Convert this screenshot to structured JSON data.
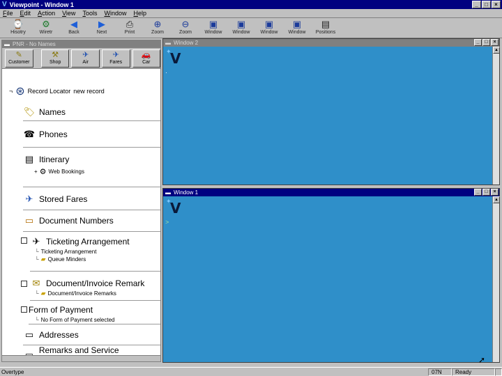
{
  "window": {
    "title": "Viewpoint - Window 1",
    "app_icon": "V",
    "controls": {
      "minimize": "_",
      "maximize": "□",
      "close": "×"
    }
  },
  "menu": [
    "File",
    "Edit",
    "Action",
    "View",
    "Tools",
    "Window",
    "Help"
  ],
  "toolbar": {
    "tools": [
      {
        "label": "Hisotry",
        "icon": "history-icon",
        "glyph": "⌚"
      },
      {
        "label": "Wiretr",
        "icon": "wireless-icon",
        "glyph": "⚙"
      },
      {
        "label": "Back",
        "icon": "back-arrow-icon",
        "glyph": "◀"
      },
      {
        "label": "Next",
        "icon": "next-arrow-icon",
        "glyph": "▶"
      },
      {
        "label": "Print",
        "icon": "printer-icon",
        "glyph": "⎙"
      },
      {
        "label": "Zoom",
        "icon": "zoom-in-icon",
        "glyph": "⊕"
      },
      {
        "label": "Zoom",
        "icon": "zoom-out-icon",
        "glyph": "⊖"
      },
      {
        "label": "Window",
        "icon": "window-1-icon",
        "glyph": "▣"
      },
      {
        "label": "Window",
        "icon": "window-2-icon",
        "glyph": "▣"
      },
      {
        "label": "Window",
        "icon": "window-3-icon",
        "glyph": "▣"
      },
      {
        "label": "Window",
        "icon": "window-4-icon",
        "glyph": "▣"
      },
      {
        "label": "Positions",
        "icon": "positions-icon",
        "glyph": "▤"
      }
    ]
  },
  "pnr": {
    "title": "PNR - No Names",
    "buttons": [
      {
        "label": "Customer",
        "icon": "customer-icon",
        "glyph": "✎"
      },
      {
        "label": "Shop",
        "icon": "shop-icon",
        "glyph": "⚒"
      },
      {
        "label": "Air",
        "icon": "air-icon",
        "glyph": "✈"
      },
      {
        "label": "Fares",
        "icon": "fares-icon",
        "glyph": "✈"
      },
      {
        "label": "Car",
        "icon": "car-icon",
        "glyph": "🚗"
      }
    ],
    "record_locator_label": "Record Locator",
    "record_locator_value": "new record",
    "sections": [
      {
        "name": "Names",
        "icon": "names-tag-icon",
        "glyph": "🏷"
      },
      {
        "name": "Phones",
        "icon": "phone-icon",
        "glyph": "☎"
      },
      {
        "name": "Itinerary",
        "icon": "itinerary-icon",
        "glyph": "▤"
      },
      {
        "name": "Stored Fares",
        "icon": "stored-fares-icon",
        "glyph": "✈"
      },
      {
        "name": "Document Numbers",
        "icon": "document-numbers-icon",
        "glyph": "▭"
      },
      {
        "name": "Ticketing Arrangement",
        "icon": "ticketing-icon",
        "glyph": "✈"
      },
      {
        "name": "Document/Invoice Remark",
        "icon": "invoice-remark-icon",
        "glyph": "✉"
      },
      {
        "name": "Form of Payment"
      },
      {
        "name": "Addresses",
        "icon": "address-icon",
        "glyph": "▭"
      },
      {
        "name": "Remarks and Service Information",
        "icon": "remarks-icon",
        "glyph": "▭"
      }
    ],
    "web_bookings": "Web Bookings",
    "ticketing_sub": [
      "Ticketing Arrangement",
      "Queue Minders"
    ],
    "invoice_sub": "Document/Invoice Remarks",
    "payment_sub": "No Form of Payment selected"
  },
  "windows": [
    {
      "title": "Window 2",
      "active": false
    },
    {
      "title": "Window 1",
      "active": true
    }
  ],
  "status": {
    "left": "Overtype",
    "code": "07N",
    "state": "Ready"
  }
}
